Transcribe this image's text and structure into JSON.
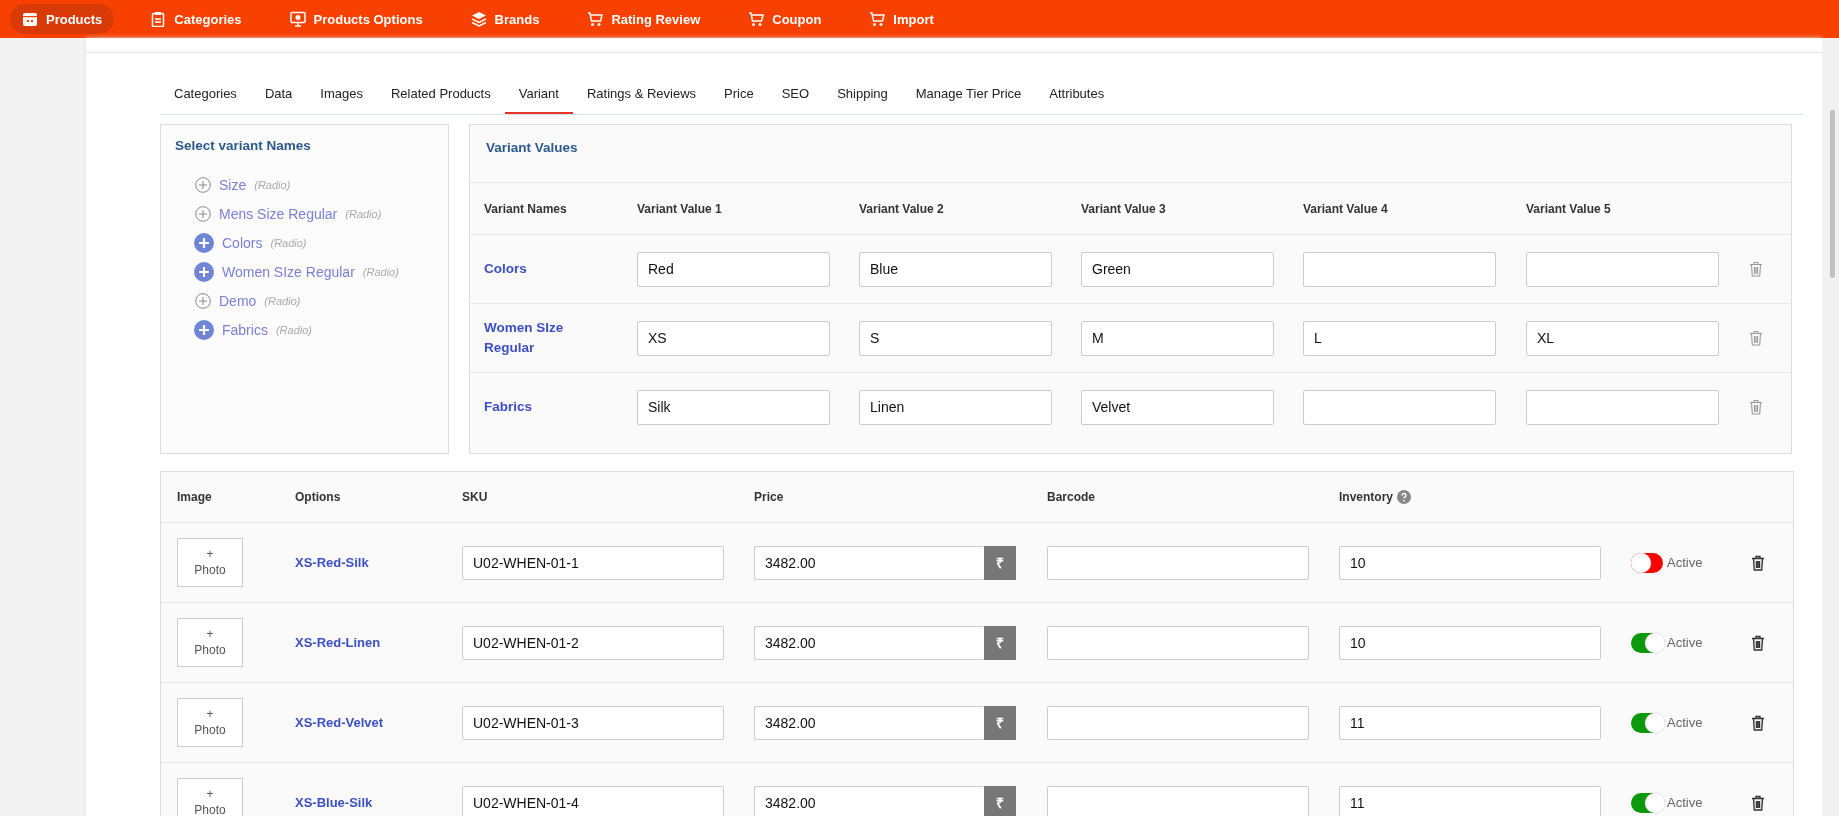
{
  "nav": [
    {
      "label": "Products",
      "kind": "box",
      "selected": true
    },
    {
      "label": "Categories",
      "kind": "clipboard",
      "selected": false
    },
    {
      "label": "Products Options",
      "kind": "monitor",
      "selected": false
    },
    {
      "label": "Brands",
      "kind": "layers",
      "selected": false
    },
    {
      "label": "Rating Review",
      "kind": "cart",
      "selected": false
    },
    {
      "label": "Coupon",
      "kind": "cart",
      "selected": false
    },
    {
      "label": "Import",
      "kind": "cart",
      "selected": false
    }
  ],
  "tabs": [
    {
      "label": "Categories",
      "selected": false
    },
    {
      "label": "Data",
      "selected": false
    },
    {
      "label": "Images",
      "selected": false
    },
    {
      "label": "Related Products",
      "selected": false
    },
    {
      "label": "Variant",
      "selected": true
    },
    {
      "label": "Ratings & Reviews",
      "selected": false
    },
    {
      "label": "Price",
      "selected": false
    },
    {
      "label": "SEO",
      "selected": false
    },
    {
      "label": "Shipping",
      "selected": false
    },
    {
      "label": "Manage Tier Price",
      "selected": false
    },
    {
      "label": "Attributes",
      "selected": false
    }
  ],
  "variant_names": {
    "title": "Select variant Names",
    "items": [
      {
        "name": "Size",
        "type": "(Radio)",
        "selected": false
      },
      {
        "name": "Mens Size Regular",
        "type": "(Radio)",
        "selected": false
      },
      {
        "name": "Colors",
        "type": "(Radio)",
        "selected": true
      },
      {
        "name": "Women SIze Regular",
        "type": "(Radio)",
        "selected": true
      },
      {
        "name": "Demo",
        "type": "(Radio)",
        "selected": false
      },
      {
        "name": "Fabrics",
        "type": "(Radio)",
        "selected": true
      }
    ]
  },
  "variant_values": {
    "title": "Variant Values",
    "columns": [
      "Variant Names",
      "Variant Value 1",
      "Variant Value 2",
      "Variant Value 3",
      "Variant Value 4",
      "Variant Value 5"
    ],
    "rows": [
      {
        "name": "Colors",
        "values": [
          "Red",
          "Blue",
          "Green"
        ]
      },
      {
        "name": "Women SIze Regular",
        "values": [
          "XS",
          "S",
          "M",
          "L",
          "XL"
        ]
      },
      {
        "name": "Fabrics",
        "values": [
          "Silk",
          "Linen",
          "Velvet"
        ]
      }
    ]
  },
  "variants": {
    "columns": [
      "Image",
      "Options",
      "SKU",
      "Price",
      "Barcode",
      "Inventory"
    ],
    "rows": [
      {
        "photo": "+",
        "photo_label": "Photo",
        "option": "XS-Red-Silk",
        "sku": "U02-WHEN-01-1",
        "price": "3482.00",
        "currency": "₹",
        "inventory": "10",
        "on": false,
        "status": "Active"
      },
      {
        "photo": "+",
        "photo_label": "Photo",
        "option": "XS-Red-Linen",
        "sku": "U02-WHEN-01-2",
        "price": "3482.00",
        "currency": "₹",
        "inventory": "10",
        "on": true,
        "status": "Active"
      },
      {
        "photo": "+",
        "photo_label": "Photo",
        "option": "XS-Red-Velvet",
        "sku": "U02-WHEN-01-3",
        "price": "3482.00",
        "currency": "₹",
        "inventory": "11",
        "on": true,
        "status": "Active"
      },
      {
        "photo": "+",
        "photo_label": "Photo",
        "option": "XS-Blue-Silk",
        "sku": "U02-WHEN-01-4",
        "price": "3482.00",
        "currency": "₹",
        "inventory": "11",
        "on": true,
        "status": "Active"
      }
    ]
  }
}
